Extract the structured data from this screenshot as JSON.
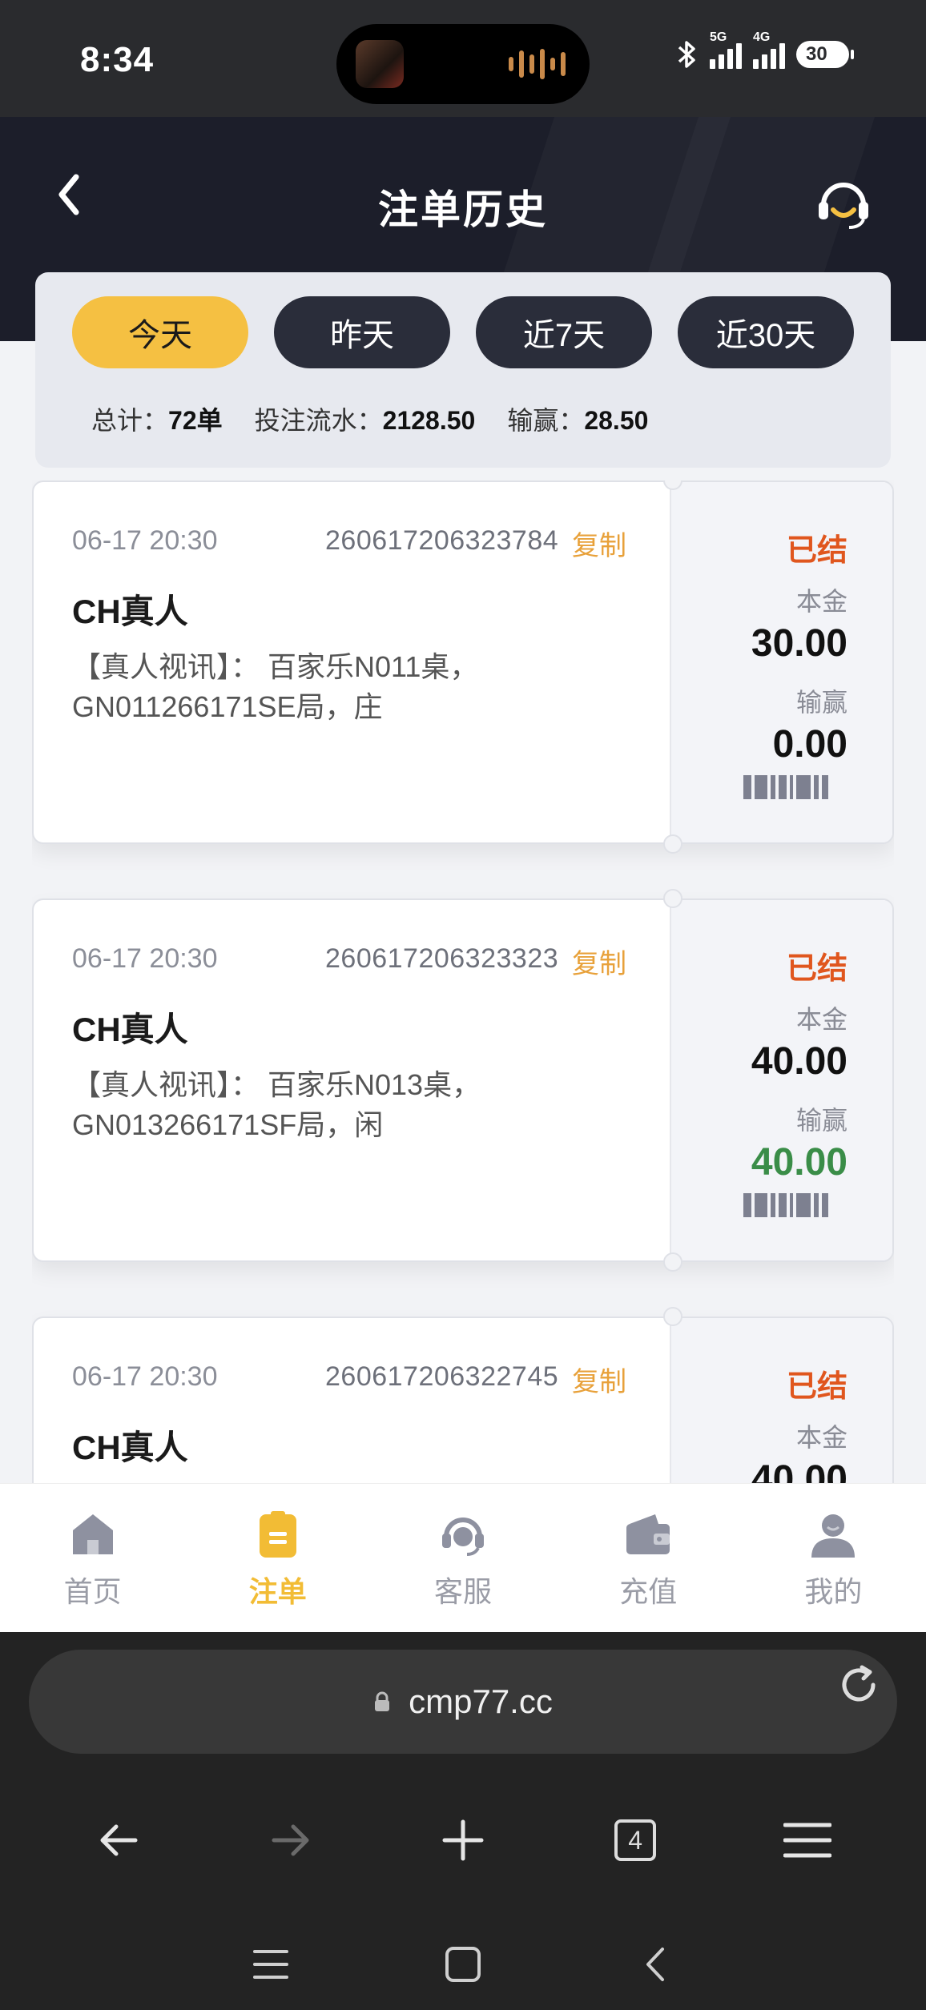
{
  "status_bar": {
    "time": "8:34",
    "network_1": "5G",
    "network_2": "4G",
    "battery": "30"
  },
  "header": {
    "title": "注单历史",
    "back_icon": "chevron-left-icon",
    "support_icon": "headset-icon"
  },
  "filter": {
    "tabs": [
      "今天",
      "昨天",
      "近7天",
      "近30天"
    ],
    "active_tab": "今天",
    "summary": {
      "total_label": "总计：",
      "total_value": "72单",
      "turnover_label": "投注流水：",
      "turnover_value": "2128.50",
      "winloss_label": "输赢：",
      "winloss_value": "28.50"
    }
  },
  "orders": [
    {
      "time": "06-17 20:30",
      "order_no": "260617206323784",
      "copy_label": "复制",
      "game": "CH真人",
      "desc_line1": "【真人视讯】： 百家乐N011桌，",
      "desc_line2": "GN011266171SE局，庄",
      "status": "已结",
      "principal_label": "本金",
      "principal": "30.00",
      "winloss_label": "输赢",
      "winloss": "0.00"
    },
    {
      "time": "06-17 20:30",
      "order_no": "260617206323323",
      "copy_label": "复制",
      "game": "CH真人",
      "desc_line1": "【真人视讯】： 百家乐N013桌，",
      "desc_line2": "GN013266171SF局，闲",
      "status": "已结",
      "principal_label": "本金",
      "principal": "40.00",
      "winloss_label": "输赢",
      "winloss": "40.00"
    },
    {
      "time": "06-17 20:30",
      "order_no": "260617206322745",
      "copy_label": "复制",
      "game": "CH真人",
      "desc_line1": "",
      "desc_line2": "",
      "status": "已结",
      "principal_label": "本金",
      "principal": "40.00",
      "winloss_label": "",
      "winloss": ""
    }
  ],
  "bottom_nav": {
    "items": [
      {
        "label": "首页",
        "icon": "home-icon"
      },
      {
        "label": "注单",
        "icon": "clipboard-icon"
      },
      {
        "label": "客服",
        "icon": "headset-icon"
      },
      {
        "label": "充值",
        "icon": "wallet-icon"
      },
      {
        "label": "我的",
        "icon": "user-icon"
      }
    ],
    "active": "注单"
  },
  "browser": {
    "url": "cmp77.cc",
    "tab_count": "4"
  },
  "colors": {
    "accent": "#f5c042",
    "header_bg": "#1c1e2a",
    "status_settled": "#e0561e",
    "win_positive": "#3a8d48"
  }
}
